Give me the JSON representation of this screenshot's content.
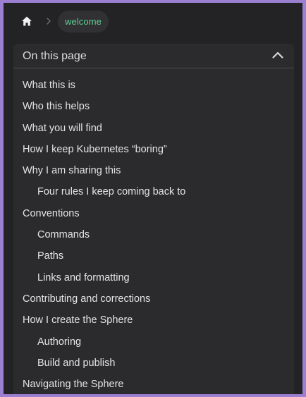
{
  "breadcrumb": {
    "home_icon": "home-icon",
    "separator_icon": "chevron-right-icon",
    "current": "welcome"
  },
  "toc": {
    "title": "On this page",
    "toggle_icon": "chevron-up-icon",
    "items": [
      {
        "label": "What this is",
        "level": 1
      },
      {
        "label": "Who this helps",
        "level": 1
      },
      {
        "label": "What you will find",
        "level": 1
      },
      {
        "label": "How I keep Kubernetes “boring”",
        "level": 1
      },
      {
        "label": "Why I am sharing this",
        "level": 1
      },
      {
        "label": "Four rules I keep coming back to",
        "level": 2
      },
      {
        "label": "Conventions",
        "level": 1
      },
      {
        "label": "Commands",
        "level": 2
      },
      {
        "label": "Paths",
        "level": 2
      },
      {
        "label": "Links and formatting",
        "level": 2
      },
      {
        "label": "Contributing and corrections",
        "level": 1
      },
      {
        "label": "How I create the Sphere",
        "level": 1
      },
      {
        "label": "Authoring",
        "level": 2
      },
      {
        "label": "Build and publish",
        "level": 2
      },
      {
        "label": "Navigating the Sphere",
        "level": 1
      }
    ]
  },
  "colors": {
    "frame_border": "#9b7fd0",
    "background": "#232325",
    "panel": "#2b2b2d",
    "accent_green": "#5fcf93",
    "text": "#e4e4e4"
  }
}
